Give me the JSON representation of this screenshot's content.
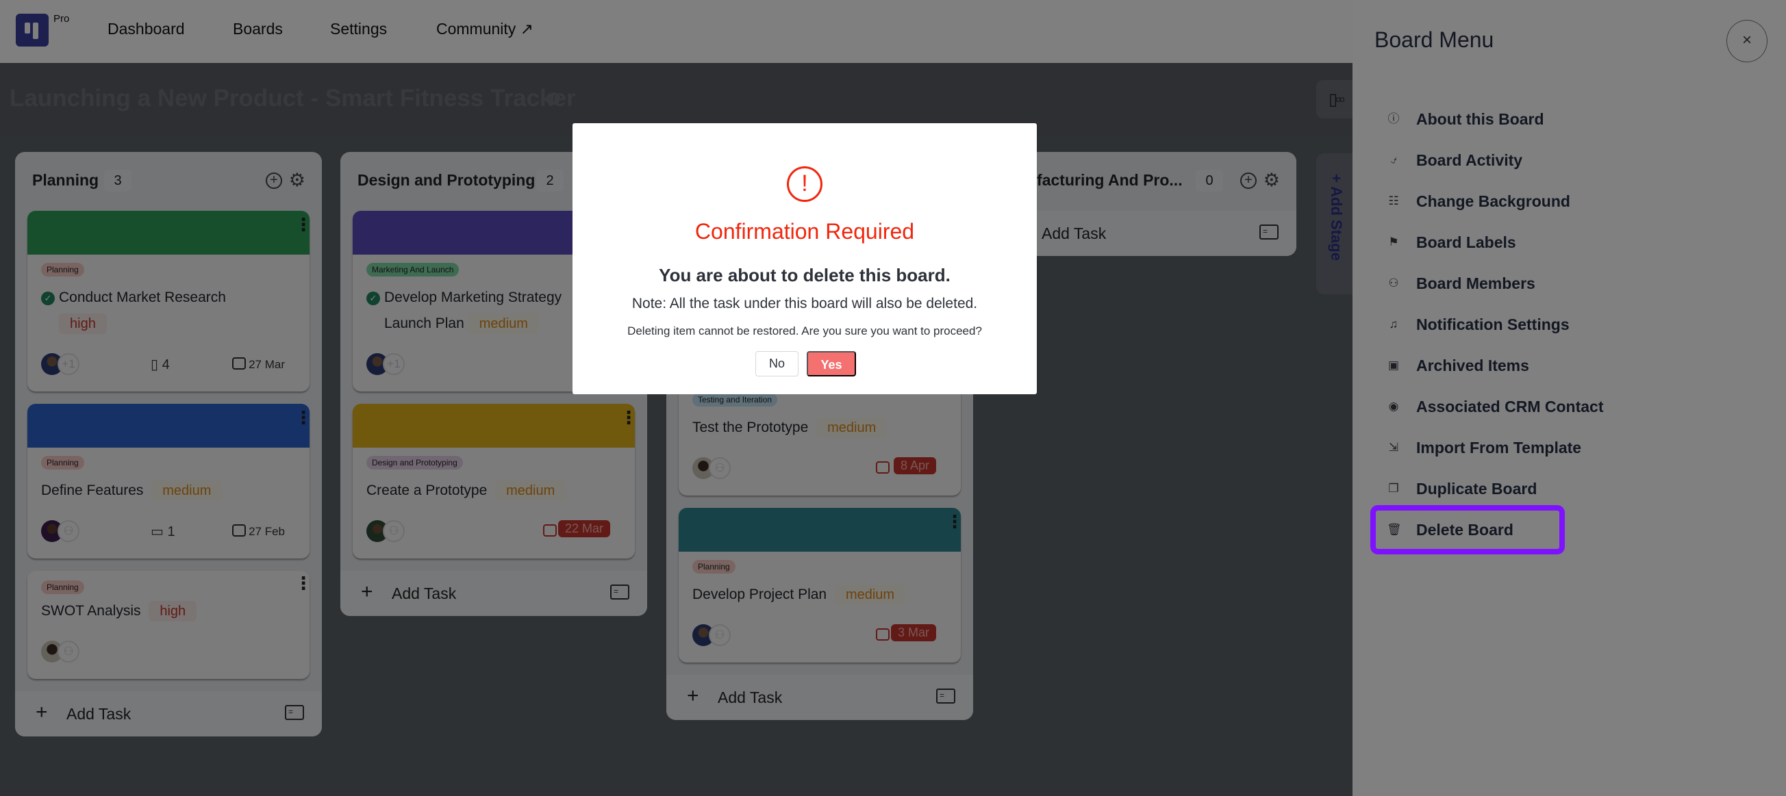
{
  "nav": {
    "logo_badge": "Pro",
    "items": [
      "Dashboard",
      "Boards",
      "Settings",
      "Community ↗"
    ]
  },
  "board": {
    "title": "Launching a New Product - Smart Fitness Tracker",
    "info_icon": "i",
    "view_toggle_icon": "kanban-icon",
    "add_stage_label": "+ Add Stage"
  },
  "columns": [
    {
      "title": "Planning",
      "count": "3",
      "add_task_label": "Add Task",
      "cards": [
        {
          "cover": "#2e9e5b",
          "label": "Planning",
          "label_color": "#f5c9c3",
          "title": "Conduct Market Research",
          "completed": true,
          "priority": "high",
          "avatar_extra": "+1",
          "attachments": "4",
          "date": "27 Mar",
          "overdue": false
        },
        {
          "cover": "#2d62cc",
          "label": "Planning",
          "label_color": "#f5c9c3",
          "title": "Define Features",
          "completed": false,
          "priority": "medium",
          "avatar_extra": "add-member-icon",
          "comments": "1",
          "date": "27 Feb",
          "overdue": false
        },
        {
          "cover": null,
          "label": "Planning",
          "label_color": "#f5c9c3",
          "title": "SWOT Analysis",
          "completed": false,
          "priority": "high",
          "avatar_extra": "add-member-icon"
        }
      ]
    },
    {
      "title": "Design and Prototyping",
      "count": "2",
      "add_task_label": "Add Task",
      "cards": [
        {
          "cover": "#5a4bbb",
          "label": "Marketing And Launch",
          "label_color": "#7fd6a4",
          "title": "Develop Marketing Strategy and Launch Plan",
          "title_line1": "Develop Marketing Strategy",
          "title_line2": "Launch Plan",
          "completed": true,
          "priority": "medium",
          "avatar_extra": "+1"
        },
        {
          "cover": "#e0b019",
          "label": "Design and Prototyping",
          "label_color": "#e2cfe5",
          "title": "Create a Prototype",
          "completed": false,
          "priority": "medium",
          "avatar_extra": "add-member-icon",
          "date": "22 Mar",
          "overdue": true
        }
      ]
    },
    {
      "title": "",
      "count": "",
      "add_task_label": "Add Task",
      "cards": [
        {
          "cover": "#f0a11f",
          "label": "Testing and Iteration",
          "label_color": "#bfe0f2",
          "title": "Test the Prototype",
          "completed": false,
          "priority": "medium",
          "avatar_extra": "add-member-icon",
          "date": "8 Apr",
          "overdue": true
        },
        {
          "cover": "#2e8791",
          "label": "Planning",
          "label_color": "#f5c9c3",
          "title": "Develop Project Plan",
          "completed": false,
          "priority": "medium",
          "avatar_extra": "add-member-icon",
          "date": "3 Mar",
          "overdue": true
        }
      ]
    },
    {
      "title": "ufacturing And Pro...",
      "count": "0",
      "add_task_label": "Add Task",
      "cards": []
    }
  ],
  "drawer": {
    "title": "Board Menu",
    "close_icon": "×",
    "items": [
      {
        "label": "About this Board",
        "icon": "info-icon"
      },
      {
        "label": "Board Activity",
        "icon": "activity-icon"
      },
      {
        "label": "Change Background",
        "icon": "background-icon"
      },
      {
        "label": "Board Labels",
        "icon": "flag-icon"
      },
      {
        "label": "Board Members",
        "icon": "members-icon"
      },
      {
        "label": "Notification Settings",
        "icon": "bell-icon"
      },
      {
        "label": "Archived Items",
        "icon": "archive-icon"
      },
      {
        "label": "Associated CRM Contact",
        "icon": "user-circle-icon"
      },
      {
        "label": "Import From Template",
        "icon": "import-icon"
      },
      {
        "label": "Duplicate Board",
        "icon": "duplicate-icon"
      },
      {
        "label": "Delete Board",
        "icon": "trash-icon",
        "highlighted": true
      }
    ],
    "highlight_color": "#7e12ff"
  },
  "modal": {
    "icon": "!",
    "title": "Confirmation Required",
    "heading": "You are about to delete this board.",
    "note": "Note: All the task under this board will also be deleted.",
    "warning": "Deleting item cannot be restored. Are you sure you want to proceed?",
    "no_label": "No",
    "yes_label": "Yes",
    "accent_color": "#f1260c",
    "yes_color": "#f47170"
  }
}
